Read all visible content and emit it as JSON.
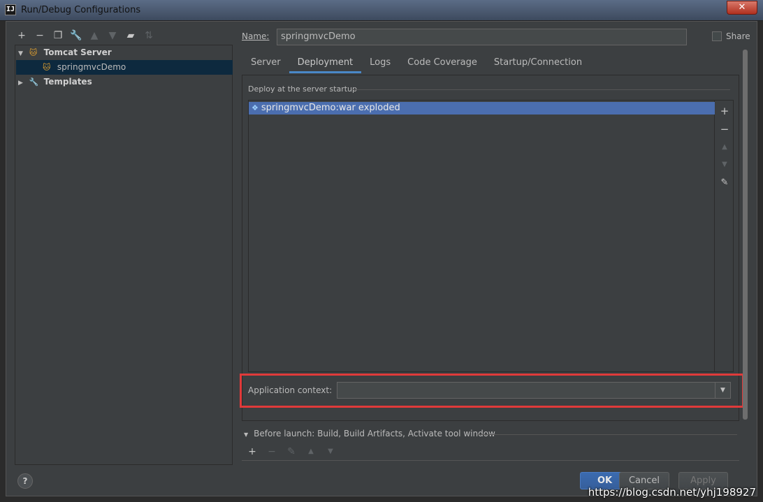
{
  "window": {
    "title": "Run/Debug Configurations",
    "close_label": "✕",
    "app_icon": "IJ"
  },
  "toolbar": {
    "icons": [
      "add-icon",
      "remove-icon",
      "copy-icon",
      "wrench-icon",
      "move-up-icon",
      "move-down-icon",
      "new-folder-icon",
      "sort-icon"
    ]
  },
  "tree": {
    "tomcat_label": "Tomcat Server",
    "item_label": "springmvcDemo",
    "templates_label": "Templates"
  },
  "name_field": {
    "label": "Name:",
    "value": "springmvcDemo"
  },
  "share": {
    "label": "Share",
    "checked": false
  },
  "tabs": [
    "Server",
    "Deployment",
    "Logs",
    "Code Coverage",
    "Startup/Connection"
  ],
  "active_tab": "Deployment",
  "deploy": {
    "section_label": "Deploy at the server startup",
    "artifact": "springmvcDemo:war exploded"
  },
  "app_context": {
    "label": "Application context:",
    "value": ""
  },
  "before_launch": {
    "label": "Before launch: Build, Build Artifacts, Activate tool window"
  },
  "buttons": {
    "ok": "OK",
    "cancel": "Cancel",
    "apply": "Apply",
    "help": "?"
  },
  "watermark": "https://blog.csdn.net/yhj198927",
  "colors": {
    "accent": "#4b6eaf",
    "highlight_box": "#e03a3a",
    "ok_button": "#365f9b"
  }
}
